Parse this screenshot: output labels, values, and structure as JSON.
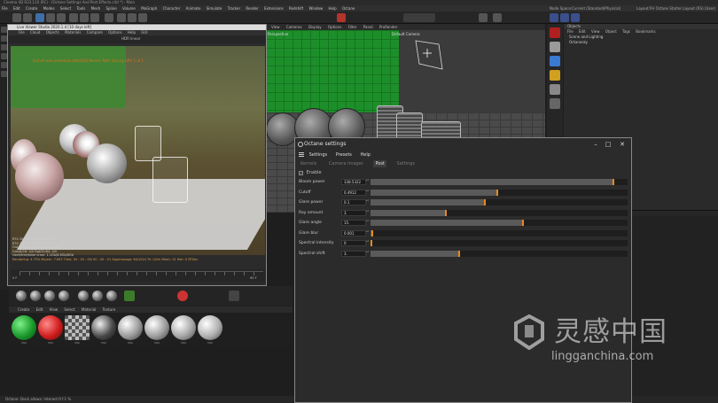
{
  "app": {
    "title": "Cinema 4D R23.110 (RC) - [Octane Settings And Post Effects.c4d *] - Main"
  },
  "menubar": {
    "items": [
      "File",
      "Edit",
      "Create",
      "Modes",
      "Select",
      "Tools",
      "Mesh",
      "Spline",
      "Volume",
      "MoGraph",
      "Character",
      "Animate",
      "Simulate",
      "Tracker",
      "Render",
      "Extensions",
      "Redshift",
      "Window",
      "Help",
      "Octane"
    ],
    "node_space_label": "Node Space:",
    "node_space_value": "Current (Standard/Physical)",
    "layout_label": "Layout:",
    "layout_value": "FH Octane Starter Layout (RS) (User)"
  },
  "viewport": {
    "menu": [
      "View",
      "Cameras",
      "Display",
      "Options",
      "Filter",
      "Panel",
      "ProRender"
    ],
    "label_perspective": "Perspective",
    "label_camera": "Default Camera"
  },
  "live_viewer": {
    "title": "Live Viewer Studio 2020.1.4 [10 days left]",
    "menu": [
      "File",
      "Cloud",
      "Objects",
      "Materials",
      "Compare",
      "Options",
      "Help",
      "GUI"
    ],
    "render_mode": "HDR linear",
    "warning": "Out-of-core used/max:0Kb/4Gb  Kernel: Path tracing  GPU 1 of 1",
    "stats": [
      "RTX 2080 SUPER[1]   6.1   7%",
      "RTX 2080 SUPER[1]   6.6   7%",
      "Out-of-core used/max:0Kb/4Gb",
      "Grey8/16: 0/0    Rgb32/64: 4/0",
      "Used/free/total vram: 1.2Gb/6.8Gb/8Gb"
    ],
    "progress_line": "Rendering: 4.75%   Ms/sec: 7.652   Time: 00 : 00 : 00/ 00 : 00 : 01   Spp/maxspp: 64/1024   Tri: 0/2m   Mesh: 12   Hair: 0   RTXon"
  },
  "timeline": {
    "frame_start": "0 F",
    "frame_end": "90 F",
    "ticks": [
      "0",
      "5",
      "10",
      "15",
      "20",
      "25",
      "30",
      "35",
      "40",
      "45",
      "50",
      "55",
      "60",
      "65",
      "70",
      "75",
      "80",
      "85",
      "90"
    ]
  },
  "materials_panel": {
    "menu": [
      "Create",
      "Edit",
      "View",
      "Select",
      "Material",
      "Texture"
    ],
    "swatches": [
      {
        "label": "Mat",
        "color": "#1a9a2a"
      },
      {
        "label": "Mat",
        "color": "#d01d1d"
      },
      {
        "label": "Mat",
        "color": "#8a8a8a"
      },
      {
        "label": "Mat",
        "color": "#4a4a4a"
      },
      {
        "label": "Mat",
        "color": "#9a9a9a"
      },
      {
        "label": "Mat",
        "color": "#9c9c9c"
      },
      {
        "label": "Mat",
        "color": "#a5a5a5"
      },
      {
        "label": "Mat",
        "color": "#b0b0b0"
      }
    ]
  },
  "objects_panel": {
    "header": "Objects",
    "menu": [
      "File",
      "Edit",
      "View",
      "Object",
      "Tags",
      "Bookmarks"
    ],
    "rows": [
      "Scene and Lighting",
      "Octanesky"
    ]
  },
  "status_bar": {
    "text": "Octane: Dock allows: Interact:0 f.1 %"
  },
  "octane_settings": {
    "title": "Octane settings",
    "menu": [
      "Settings",
      "Presets",
      "Help"
    ],
    "tabs": [
      "Kernels",
      "Camera Imager",
      "Post",
      "Settings"
    ],
    "active_tab": "Post",
    "enable_label": "Enable",
    "enabled": true,
    "params": [
      {
        "label": "Bloom power",
        "value": "338.5322",
        "fill": 0.94
      },
      {
        "label": "Cutoff",
        "value": "0.4912",
        "fill": 0.49
      },
      {
        "label": "Glare power",
        "value": "0.1",
        "fill": 0.44
      },
      {
        "label": "Ray amount",
        "value": "3",
        "fill": 0.29
      },
      {
        "label": "Glare angle",
        "value": "15.",
        "fill": 0.59
      },
      {
        "label": "Glare blur",
        "value": "0.001",
        "fill": 0.005
      },
      {
        "label": "Spectral intensity",
        "value": "0",
        "fill": 0.0
      },
      {
        "label": "Spectral shift",
        "value": "3.",
        "fill": 0.34
      }
    ]
  },
  "watermark": {
    "chinese": "灵感中国",
    "url": "lingganchina.com"
  },
  "colors": {
    "accent_orange": "#e58a1f",
    "green_wall": "#1d8f2a"
  }
}
